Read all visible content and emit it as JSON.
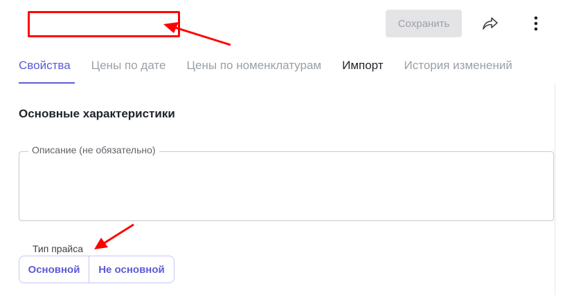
{
  "header": {
    "title_value": "",
    "save_label": "Сохранить",
    "share_icon": "share-arrow-icon",
    "more_icon": "more-vertical-icon"
  },
  "tabs": [
    {
      "label": "Свойства",
      "active": true
    },
    {
      "label": "Цены по дате",
      "active": false
    },
    {
      "label": "Цены по номенклатурам",
      "active": false
    },
    {
      "label": "Импорт",
      "active": false
    },
    {
      "label": "История изменений",
      "active": false
    }
  ],
  "section": {
    "title": "Основные характеристики"
  },
  "description": {
    "label": "Описание (не обязательно)",
    "value": ""
  },
  "price_type": {
    "label": "Тип прайса",
    "options": [
      "Основной",
      "Не основной"
    ]
  },
  "colors": {
    "accent": "#5b5bd6",
    "annotation": "#ff0000"
  }
}
